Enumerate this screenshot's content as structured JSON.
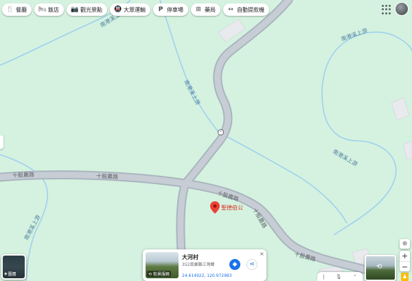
{
  "chips": [
    {
      "icon": "restaurant-icon",
      "glyph": "🍴",
      "label": "餐廳"
    },
    {
      "icon": "hotel-icon",
      "glyph": "🛏",
      "label": "飯店"
    },
    {
      "icon": "camera-icon",
      "glyph": "📷",
      "label": "觀光景點"
    },
    {
      "icon": "transit-icon",
      "glyph": "🚇",
      "label": "大眾運輸"
    },
    {
      "icon": "parking-icon",
      "glyph": "P",
      "label": "停車場"
    },
    {
      "icon": "pharmacy-icon",
      "glyph": "⊞",
      "label": "藥局"
    },
    {
      "icon": "atm-icon",
      "glyph": "↔",
      "label": "自動提款機"
    }
  ],
  "map": {
    "roads": [
      "十股農路",
      "十股農路",
      "十股農路",
      "十股農路",
      "十股農路"
    ],
    "streams": [
      "南港溪上游",
      "南港溪上游",
      "南港溪上游",
      "南港溪上游",
      "南港溪上游"
    ],
    "place": {
      "name": "聖德伯公",
      "color": "#ea4335"
    }
  },
  "card": {
    "title": "大河村",
    "address": "352苗栗縣三灣鄉",
    "coords": "24.614922, 120.972983",
    "thumb_label": "街景服務",
    "close": "×"
  },
  "controls": {
    "layers_label": "圖層",
    "zoom_in": "+",
    "zoom_out": "−"
  },
  "colors": {
    "map_bg": "#d4f2df",
    "road": "#aab4bf",
    "stream": "#9fd0ef",
    "accent": "#1a73e8"
  }
}
